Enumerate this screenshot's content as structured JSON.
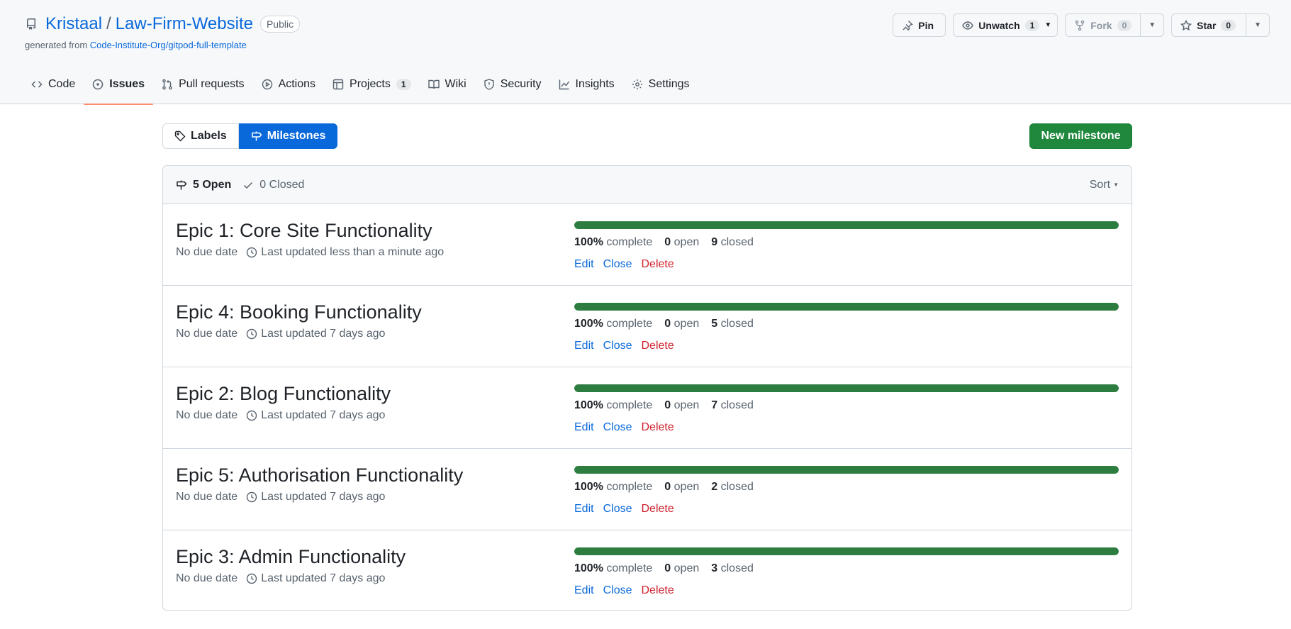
{
  "repo": {
    "owner": "Kristaal",
    "name": "Law-Firm-Website",
    "visibility": "Public",
    "generated_prefix": "generated from ",
    "template": "Code-Institute-Org/gitpod-full-template"
  },
  "actions": {
    "pin": "Pin",
    "unwatch": "Unwatch",
    "watch_count": "1",
    "fork": "Fork",
    "fork_count": "0",
    "star": "Star",
    "star_count": "0"
  },
  "tabs": [
    {
      "label": "Code"
    },
    {
      "label": "Issues"
    },
    {
      "label": "Pull requests"
    },
    {
      "label": "Actions"
    },
    {
      "label": "Projects",
      "count": "1"
    },
    {
      "label": "Wiki"
    },
    {
      "label": "Security"
    },
    {
      "label": "Insights"
    },
    {
      "label": "Settings"
    }
  ],
  "subnav": {
    "labels": "Labels",
    "milestones": "Milestones"
  },
  "new_milestone": "New milestone",
  "list_header": {
    "open": "5 Open",
    "closed": "0 Closed",
    "sort": "Sort"
  },
  "milestones": [
    {
      "title": "Epic 1: Core Site Functionality",
      "due": "No due date",
      "updated": "Last updated less than a minute ago",
      "percent": "100%",
      "percent_value": 100,
      "complete": "complete",
      "open": "0",
      "open_label": "open",
      "closed": "9",
      "closed_label": "closed"
    },
    {
      "title": "Epic 4: Booking Functionality",
      "due": "No due date",
      "updated": "Last updated 7 days ago",
      "percent": "100%",
      "percent_value": 100,
      "complete": "complete",
      "open": "0",
      "open_label": "open",
      "closed": "5",
      "closed_label": "closed"
    },
    {
      "title": "Epic 2: Blog Functionality",
      "due": "No due date",
      "updated": "Last updated 7 days ago",
      "percent": "100%",
      "percent_value": 100,
      "complete": "complete",
      "open": "0",
      "open_label": "open",
      "closed": "7",
      "closed_label": "closed"
    },
    {
      "title": "Epic 5: Authorisation Functionality",
      "due": "No due date",
      "updated": "Last updated 7 days ago",
      "percent": "100%",
      "percent_value": 100,
      "complete": "complete",
      "open": "0",
      "open_label": "open",
      "closed": "2",
      "closed_label": "closed"
    },
    {
      "title": "Epic 3: Admin Functionality",
      "due": "No due date",
      "updated": "Last updated 7 days ago",
      "percent": "100%",
      "percent_value": 100,
      "complete": "complete",
      "open": "0",
      "open_label": "open",
      "closed": "3",
      "closed_label": "closed"
    }
  ],
  "row_actions": {
    "edit": "Edit",
    "close": "Close",
    "delete": "Delete"
  },
  "colors": {
    "accent": "#0969da",
    "success": "#1f883d",
    "progress": "#2c7d3f",
    "danger": "#cf222e",
    "tab_underline": "#fd8c73"
  }
}
